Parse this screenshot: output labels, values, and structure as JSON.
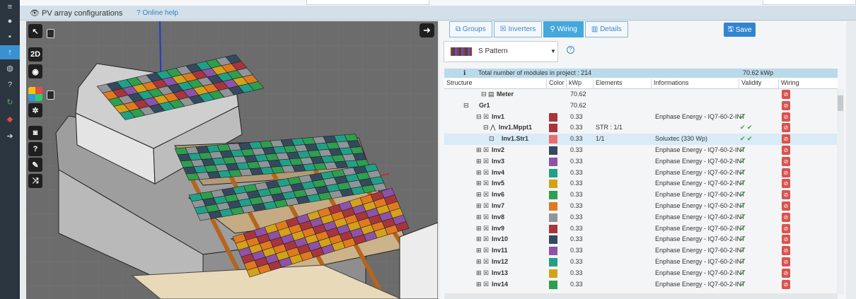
{
  "title_bar": {
    "title": "PV array configurations",
    "help": "Online help"
  },
  "toolbar": {
    "btn_2d": "2D"
  },
  "tabs": [
    {
      "label": "Groups",
      "active": false
    },
    {
      "label": "Inverters",
      "active": false
    },
    {
      "label": "Wiring",
      "active": true
    },
    {
      "label": "Details",
      "active": false
    }
  ],
  "save_label": "Save",
  "pattern": {
    "selected": "S Pattern"
  },
  "summary": {
    "text": "Total number of modules in project : 214",
    "kwp": "70.62 kWp"
  },
  "columns": [
    "Structure",
    "Color",
    "kWp",
    "Elements",
    "Informations",
    "Validity",
    "Wiring"
  ],
  "rows": [
    {
      "name": "Meter",
      "kwp": "70.62",
      "elements": "",
      "info": "",
      "validity": "",
      "color": "",
      "indent": 0,
      "icon": "meter"
    },
    {
      "name": "Gr1",
      "kwp": "70.62",
      "elements": "",
      "info": "",
      "validity": "",
      "color": "",
      "indent": 1,
      "icon": ""
    },
    {
      "name": "Inv1",
      "kwp": "0.33",
      "elements": "",
      "info": "Enphase Energy - IQ7-60-2-INT",
      "validity": "✔",
      "color": "#a7353b",
      "indent": 2,
      "icon": "inv"
    },
    {
      "name": "Inv1.Mppt1",
      "kwp": "0.33",
      "elements": "STR : 1/1",
      "info": "",
      "validity": "✔ ✔",
      "color": "#a7353b",
      "indent": 3,
      "icon": "mppt"
    },
    {
      "name": "Inv1.Str1",
      "kwp": "0.33",
      "elements": "1/1",
      "info": "Soluxtec (330 Wp)",
      "validity": "✔ ✔",
      "color": "#e86f6c",
      "indent": 4,
      "icon": "str",
      "selected": true
    },
    {
      "name": "Inv2",
      "kwp": "0.33",
      "elements": "",
      "info": "Enphase Energy - IQ7-60-2-INT",
      "validity": "✔",
      "color": "#34495e",
      "indent": 2,
      "icon": "inv"
    },
    {
      "name": "Inv3",
      "kwp": "0.33",
      "elements": "",
      "info": "Enphase Energy - IQ7-60-2-INT",
      "validity": "✔",
      "color": "#8e52a8",
      "indent": 2,
      "icon": "inv"
    },
    {
      "name": "Inv4",
      "kwp": "0.33",
      "elements": "",
      "info": "Enphase Energy - IQ7-60-2-INT",
      "validity": "✔",
      "color": "#1fa187",
      "indent": 2,
      "icon": "inv"
    },
    {
      "name": "Inv5",
      "kwp": "0.33",
      "elements": "",
      "info": "Enphase Energy - IQ7-60-2-INT",
      "validity": "✔",
      "color": "#d4a21a",
      "indent": 2,
      "icon": "inv"
    },
    {
      "name": "Inv6",
      "kwp": "0.33",
      "elements": "",
      "info": "Enphase Energy - IQ7-60-2-INT",
      "validity": "✔",
      "color": "#2e9e4f",
      "indent": 2,
      "icon": "inv"
    },
    {
      "name": "Inv7",
      "kwp": "0.33",
      "elements": "",
      "info": "Enphase Energy - IQ7-60-2-INT",
      "validity": "✔",
      "color": "#e07a1f",
      "indent": 2,
      "icon": "inv"
    },
    {
      "name": "Inv8",
      "kwp": "0.33",
      "elements": "",
      "info": "Enphase Energy - IQ7-60-2-INT",
      "validity": "✔",
      "color": "#8f9599",
      "indent": 2,
      "icon": "inv"
    },
    {
      "name": "Inv9",
      "kwp": "0.33",
      "elements": "",
      "info": "Enphase Energy - IQ7-60-2-INT",
      "validity": "✔",
      "color": "#a7353b",
      "indent": 2,
      "icon": "inv"
    },
    {
      "name": "Inv10",
      "kwp": "0.33",
      "elements": "",
      "info": "Enphase Energy - IQ7-60-2-INT",
      "validity": "✔",
      "color": "#34495e",
      "indent": 2,
      "icon": "inv"
    },
    {
      "name": "Inv11",
      "kwp": "0.33",
      "elements": "",
      "info": "Enphase Energy - IQ7-60-2-INT",
      "validity": "✔",
      "color": "#8e52a8",
      "indent": 2,
      "icon": "inv"
    },
    {
      "name": "Inv12",
      "kwp": "0.33",
      "elements": "",
      "info": "Enphase Energy - IQ7-60-2-INT",
      "validity": "✔",
      "color": "#1fa187",
      "indent": 2,
      "icon": "inv"
    },
    {
      "name": "Inv13",
      "kwp": "0.33",
      "elements": "",
      "info": "Enphase Energy - IQ7-60-2-INT",
      "validity": "✔",
      "color": "#d4a21a",
      "indent": 2,
      "icon": "inv"
    },
    {
      "name": "Inv14",
      "kwp": "0.33",
      "elements": "",
      "info": "Enphase Energy - IQ7-60-2-INT",
      "validity": "✔",
      "color": "#2e9e4f",
      "indent": 2,
      "icon": "inv"
    }
  ],
  "panel_colors": [
    "#a7353b",
    "#34495e",
    "#8e52a8",
    "#1fa187",
    "#d4a21a",
    "#2e9e4f",
    "#e07a1f",
    "#8f9599"
  ],
  "icons": {
    "sidebar": [
      "database-icon",
      "user-icon",
      "cart-icon",
      "upload-icon",
      "globe-icon",
      "question-icon",
      "refresh-icon",
      "solar-icon",
      "arrow-circle-icon"
    ],
    "viewport_tools": [
      "cursor-icon",
      "eye-icon",
      "color-palette-icon",
      "magic-icon",
      "camera-icon",
      "help-icon",
      "edit-icon",
      "shuffle-icon"
    ]
  }
}
